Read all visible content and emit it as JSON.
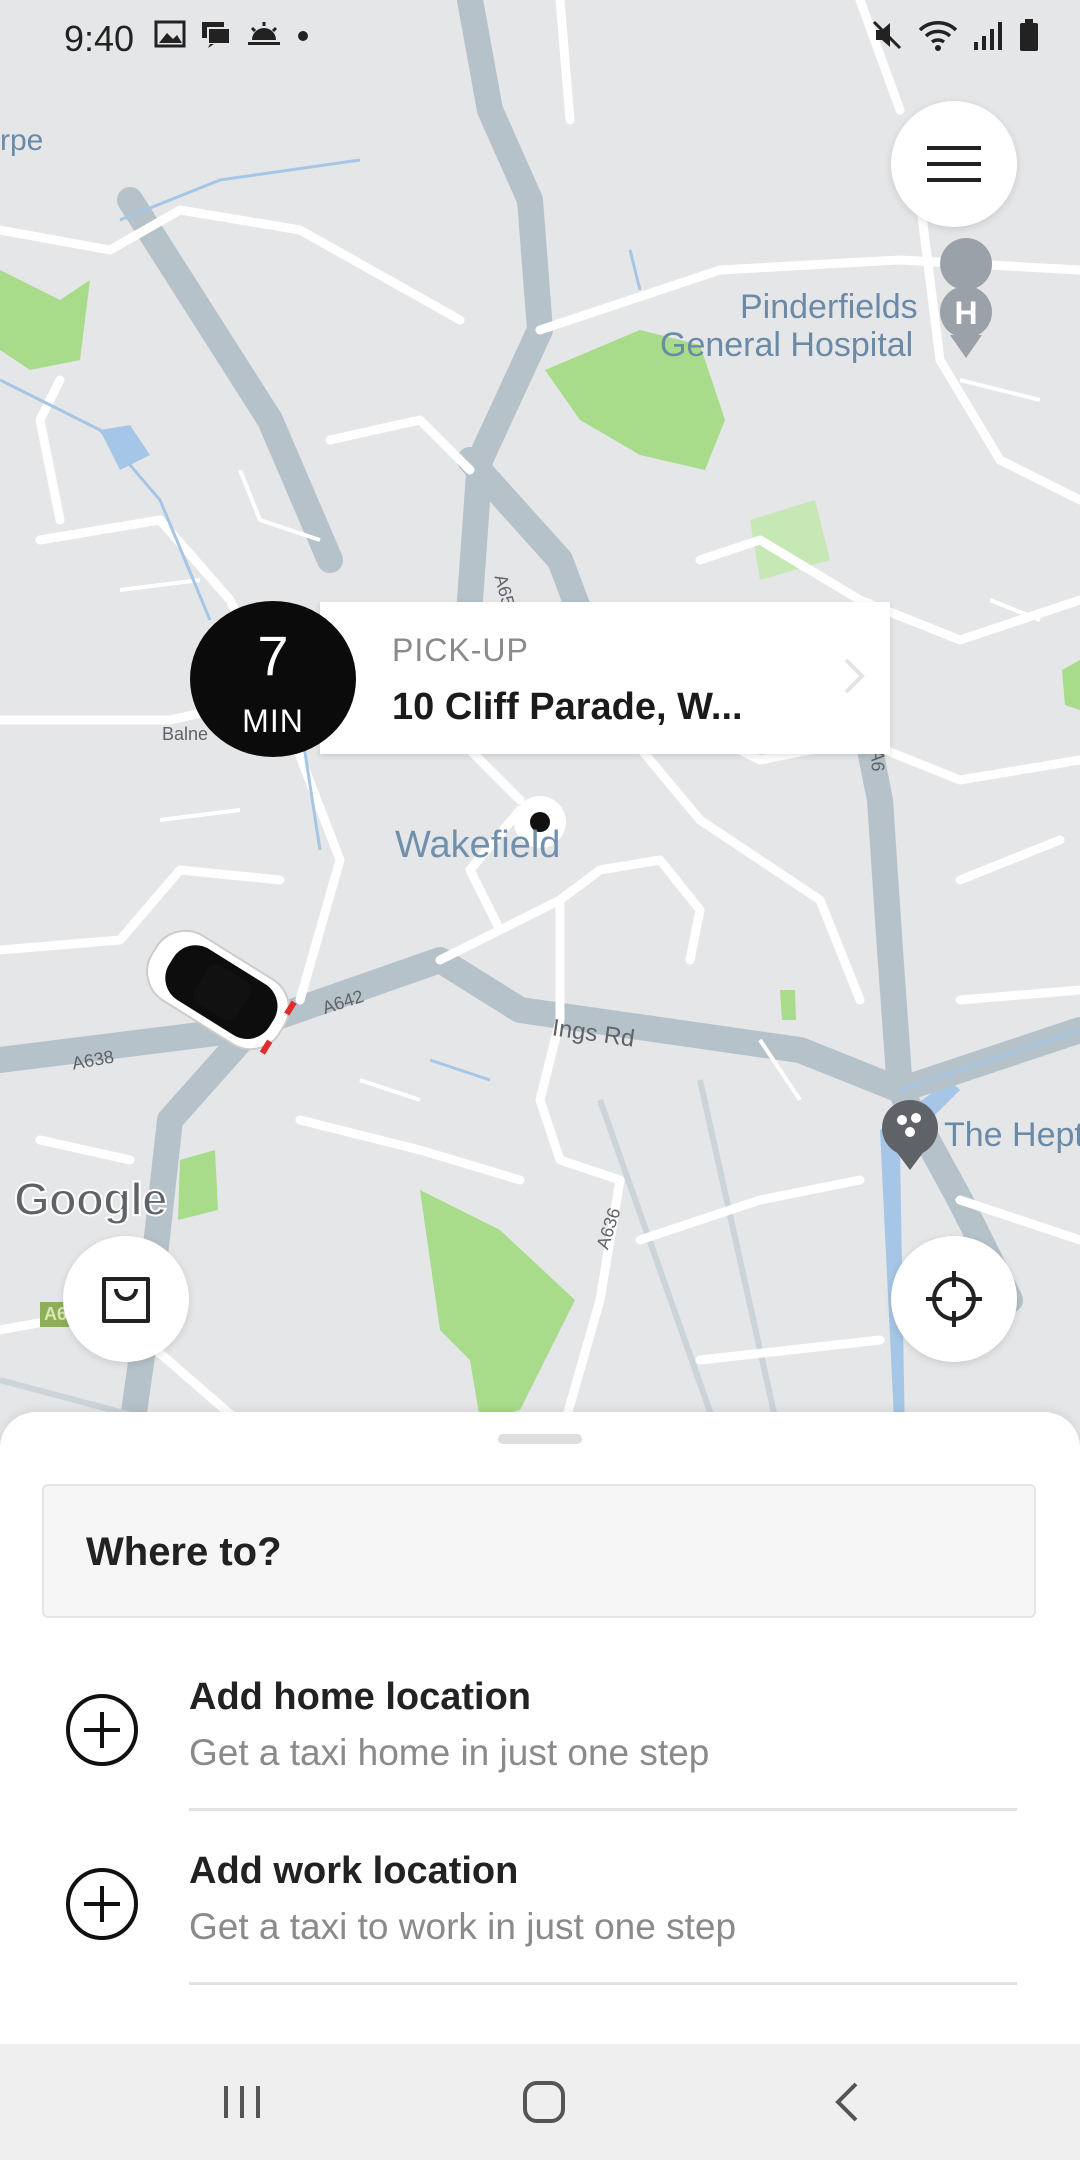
{
  "status_bar": {
    "time": "9:40",
    "left_icons": [
      "image-icon",
      "messages-icon",
      "weather-icon",
      "dot-icon"
    ],
    "right_icons": [
      "mute-icon",
      "wifi-icon",
      "signal-icon",
      "battery-icon"
    ]
  },
  "map": {
    "labels": {
      "hospital_line1": "Pinderfields",
      "hospital_line2": "General Hospital",
      "city": "Wakefield",
      "ings_rd": "Ings Rd",
      "hepworth": "The Hept",
      "partial_top_left": "rpe",
      "a642": "A642",
      "a638": "A638",
      "a636": "A636",
      "a65": "A65",
      "balne": "Balne",
      "a6_right": "A6",
      "a_bottom_left": "A6"
    },
    "brand": "Google",
    "colors": {
      "land": "#e5e6e8",
      "road": "#ffffff",
      "major_road": "#b6c2c9",
      "park": "#a8dc8a",
      "water": "#a5c6e6"
    }
  },
  "pickup": {
    "eta_value": "7",
    "eta_unit": "MIN",
    "label": "PICK-UP",
    "address": "10 Cliff Parade, W..."
  },
  "sheet": {
    "search_placeholder": "Where to?",
    "locations": [
      {
        "title": "Add home location",
        "subtitle": "Get a taxi home in just one step",
        "icon": "plus-circle-icon"
      },
      {
        "title": "Add work location",
        "subtitle": "Get a taxi to work in just one step",
        "icon": "plus-circle-icon"
      }
    ]
  },
  "nav_bar": {
    "buttons": [
      "recents-icon",
      "home-icon",
      "back-icon"
    ]
  }
}
